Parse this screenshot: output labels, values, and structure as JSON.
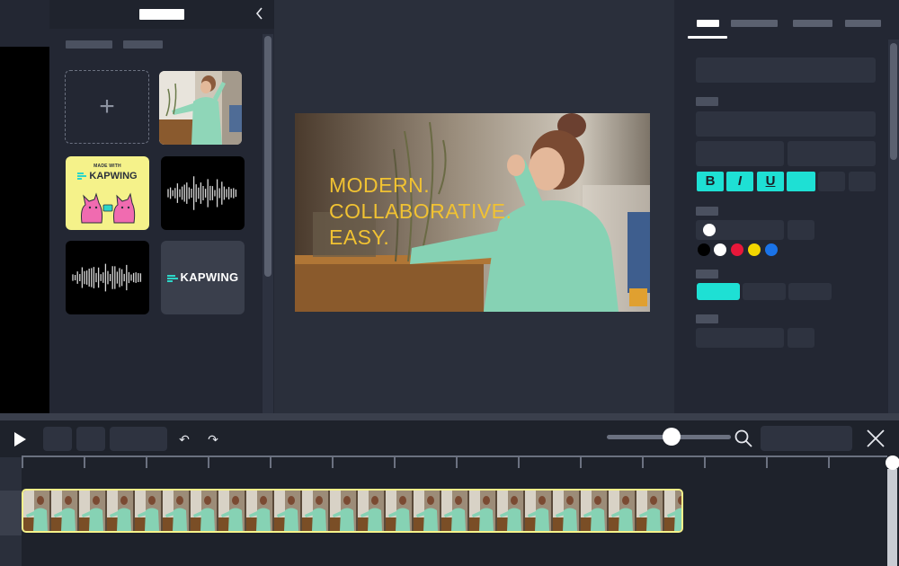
{
  "assets": {
    "upload_symbol": "+",
    "tiles": [
      {
        "name": "upload-tile",
        "kind": "upload"
      },
      {
        "name": "girl-video-tile",
        "kind": "video-thumbnail"
      },
      {
        "name": "made-with-kapwing-tile",
        "kind": "sticker",
        "caption_small": "MADE WITH",
        "caption_brand": "KAPWING"
      },
      {
        "name": "waveform-tile-1",
        "kind": "audio"
      },
      {
        "name": "waveform-tile-2",
        "kind": "audio"
      },
      {
        "name": "kapwing-logo-tile",
        "kind": "logo",
        "caption_brand": "KAPWING"
      }
    ],
    "collapse_icon": "chevron-left-icon"
  },
  "preview": {
    "overlay_lines": [
      "MODERN.",
      "COLLABORATIVE.",
      "EASY."
    ]
  },
  "properties": {
    "format_buttons": [
      "B",
      "I",
      "U"
    ],
    "color_swatches": [
      "#000000",
      "#ffffff",
      "#e8173a",
      "#f2d600",
      "#1a73e8"
    ],
    "selected_color": "#ffffff",
    "accent": "#1ee0d4"
  },
  "timeline": {
    "icons": [
      "play-icon",
      "undo-icon",
      "redo-icon",
      "zoom-search-icon",
      "close-icon"
    ],
    "undo_glyph": "↶",
    "redo_glyph": "↷",
    "zoom_level": 0.47,
    "clip_border_color": "#f5f28a"
  },
  "colors": {
    "background": "#2a2f3b",
    "panel": "#232733",
    "overlay_text": "#f1c232"
  }
}
